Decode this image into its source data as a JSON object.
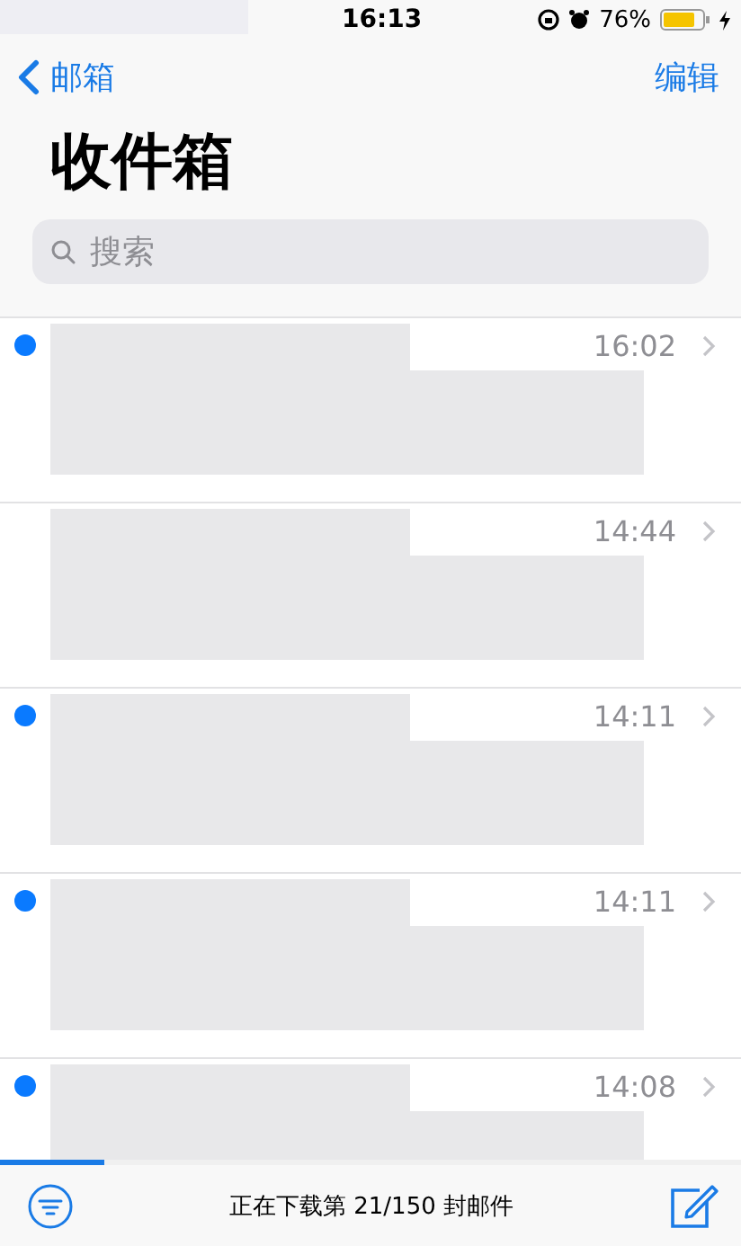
{
  "status_bar": {
    "time": "16:13",
    "battery": "76%"
  },
  "nav": {
    "back": "邮箱",
    "edit": "编辑"
  },
  "title": "收件箱",
  "search": {
    "placeholder": "搜索"
  },
  "messages": [
    {
      "time": "16:02",
      "unread": true
    },
    {
      "time": "14:44",
      "unread": false
    },
    {
      "time": "14:11",
      "unread": true
    },
    {
      "time": "14:11",
      "unread": true
    },
    {
      "time": "14:08",
      "unread": true
    }
  ],
  "toolbar": {
    "status": "正在下载第 21/150 封邮件",
    "progress": {
      "level": 0.14
    }
  }
}
